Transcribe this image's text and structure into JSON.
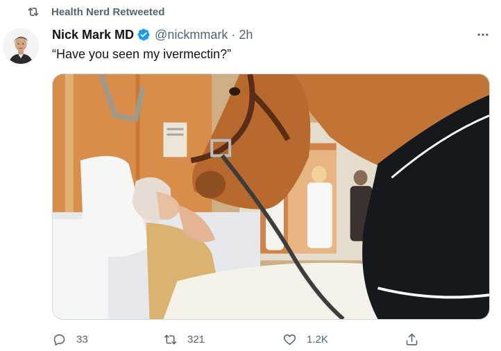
{
  "retweet_banner": {
    "text": "Health Nerd Retweeted",
    "icon": "retweet-icon"
  },
  "author": {
    "display_name": "Nick Mark MD",
    "verified_icon": "verified-badge-icon",
    "handle": "@nickmmark",
    "separator": "·",
    "time": "2h"
  },
  "tweet": {
    "text": "“Have you seen my ivermectin?”"
  },
  "more_icon": "more-horizontal-icon",
  "actions": {
    "reply_count": "33",
    "retweet_count": "321",
    "like_count": "1.2K"
  },
  "colors": {
    "text_primary": "#0f1419",
    "text_secondary": "#536471",
    "verified_blue": "#1d9bf0",
    "border": "#cfd9de"
  }
}
